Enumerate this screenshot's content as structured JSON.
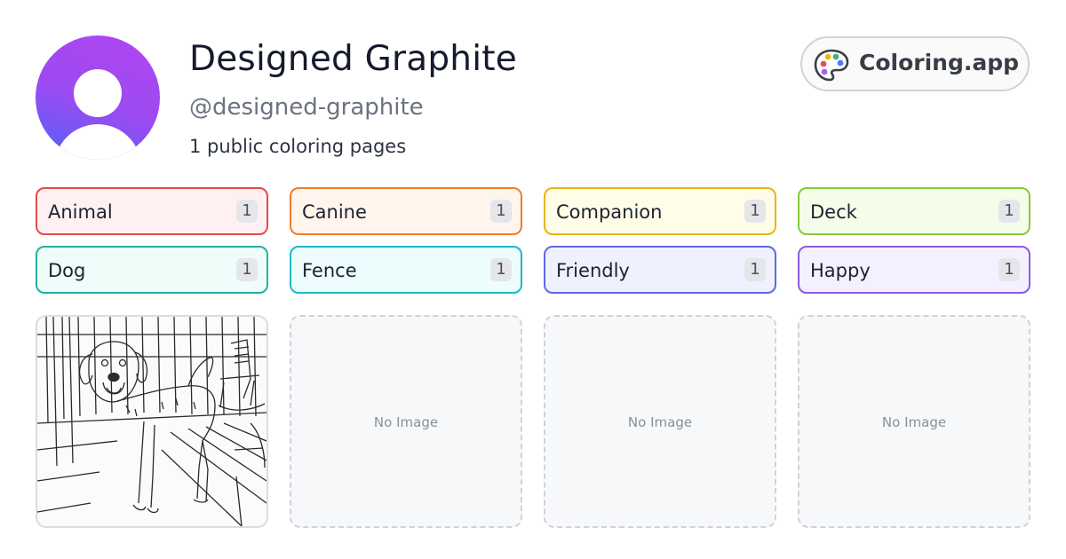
{
  "profile": {
    "name": "Designed Graphite",
    "handle": "@designed-graphite",
    "count_text": "1 public coloring pages",
    "avatar_gradient": [
      "#b245f3",
      "#4f63f7"
    ]
  },
  "brand": {
    "label": "Coloring.app",
    "icon": "palette-icon"
  },
  "tags": [
    {
      "label": "Animal",
      "count": "1",
      "border": "#e5484d",
      "bg": "#fff1f2"
    },
    {
      "label": "Canine",
      "count": "1",
      "border": "#f07c2a",
      "bg": "#fff5ec"
    },
    {
      "label": "Companion",
      "count": "1",
      "border": "#e8b512",
      "bg": "#fffce8"
    },
    {
      "label": "Deck",
      "count": "1",
      "border": "#86c93a",
      "bg": "#f4fde9"
    },
    {
      "label": "Dog",
      "count": "1",
      "border": "#1fb3a3",
      "bg": "#effcf9"
    },
    {
      "label": "Fence",
      "count": "1",
      "border": "#1eb9c6",
      "bg": "#edfcfd"
    },
    {
      "label": "Friendly",
      "count": "1",
      "border": "#5f68e6",
      "bg": "#eff1ff"
    },
    {
      "label": "Happy",
      "count": "1",
      "border": "#8d5be0",
      "bg": "#f5f0ff"
    }
  ],
  "cards": [
    {
      "kind": "image",
      "subject": "dog-on-porch-coloring-page"
    },
    {
      "kind": "placeholder",
      "text": "No Image"
    },
    {
      "kind": "placeholder",
      "text": "No Image"
    },
    {
      "kind": "placeholder",
      "text": "No Image"
    }
  ]
}
